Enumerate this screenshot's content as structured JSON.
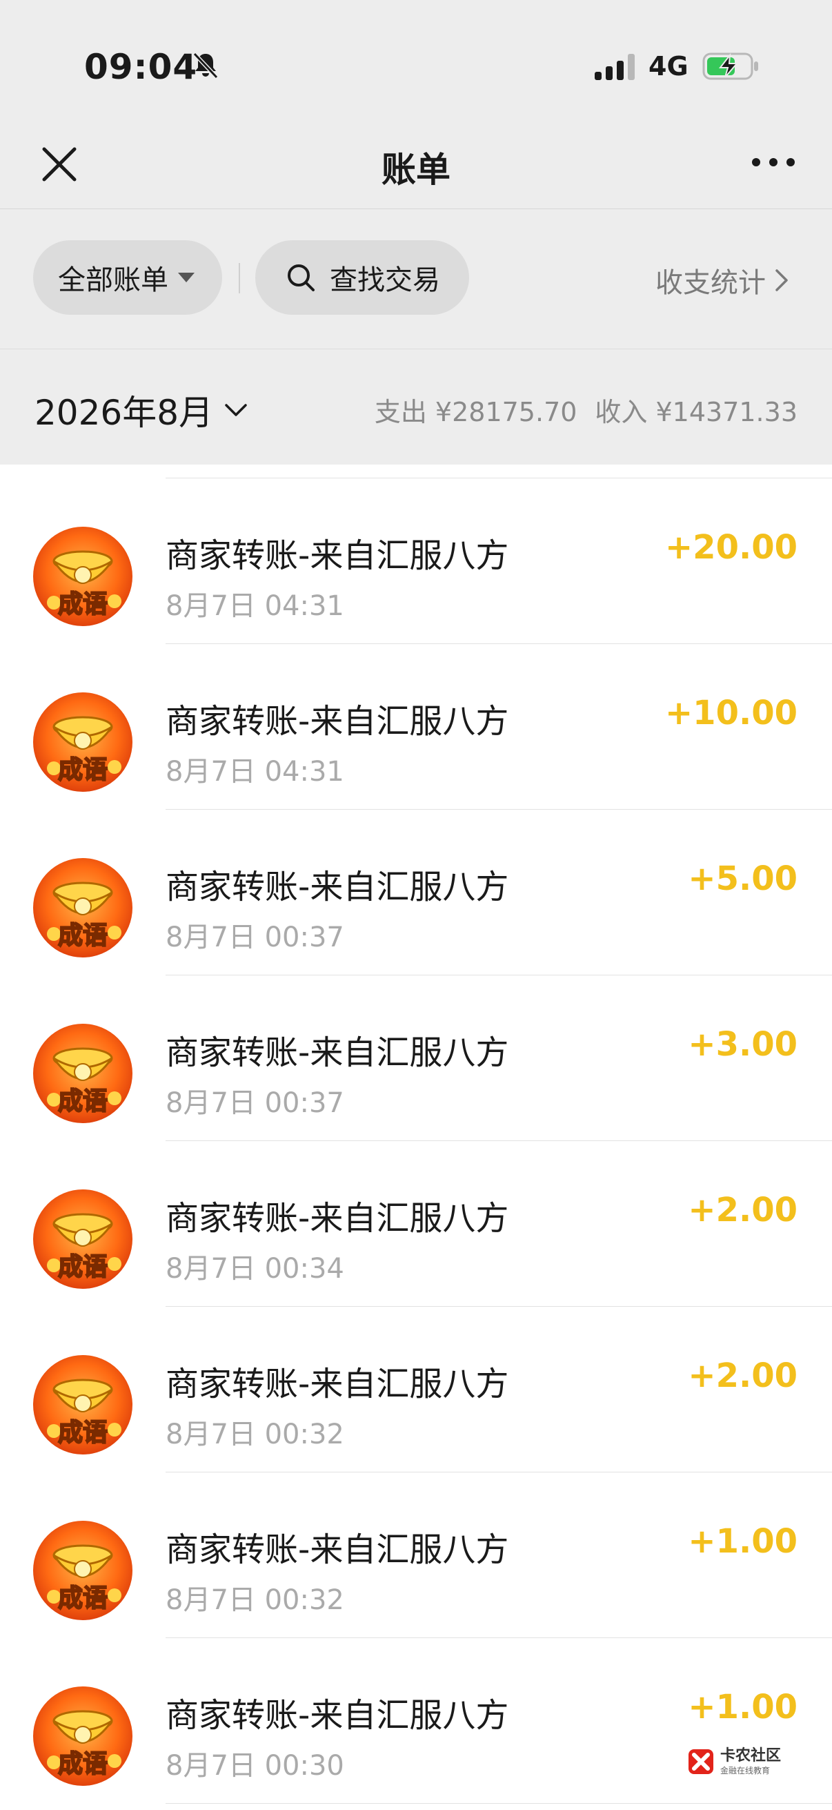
{
  "status_bar": {
    "time": "09:04",
    "network": "4G",
    "icons": [
      "bell-off-icon",
      "signal-icon",
      "battery-charging-icon"
    ]
  },
  "nav": {
    "title": "账单",
    "close_icon": "close-icon",
    "more_icon": "more-icon"
  },
  "filters": {
    "all_bills_label": "全部账单",
    "search_label": "查找交易",
    "stats_label": "收支统计"
  },
  "month": {
    "label": "2026年8月",
    "expense": "支出 ¥28175.70",
    "income": "收入 ¥14371.33"
  },
  "transactions": [
    {
      "title": "商家转账-来自汇服八方",
      "time": "8月7日 04:31",
      "amount": "+20.00"
    },
    {
      "title": "商家转账-来自汇服八方",
      "time": "8月7日 04:31",
      "amount": "+10.00"
    },
    {
      "title": "商家转账-来自汇服八方",
      "time": "8月7日 00:37",
      "amount": "+5.00"
    },
    {
      "title": "商家转账-来自汇服八方",
      "time": "8月7日 00:37",
      "amount": "+3.00"
    },
    {
      "title": "商家转账-来自汇服八方",
      "time": "8月7日 00:34",
      "amount": "+2.00"
    },
    {
      "title": "商家转账-来自汇服八方",
      "time": "8月7日 00:32",
      "amount": "+2.00"
    },
    {
      "title": "商家转账-来自汇服八方",
      "time": "8月7日 00:32",
      "amount": "+1.00"
    },
    {
      "title": "商家转账-来自汇服八方",
      "time": "8月7日 00:30",
      "amount": "+1.00"
    }
  ],
  "avatar_badge": "成语",
  "watermark": {
    "main": "卡农社区",
    "sub": "金融在线教育"
  },
  "colors": {
    "background_gray": "#ededed",
    "amount_yellow": "#f3bf1c",
    "battery_green": "#35c759"
  }
}
